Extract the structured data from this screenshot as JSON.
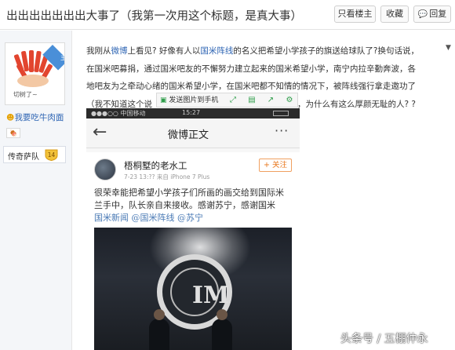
{
  "header": {
    "title": "出出出出出出出大事了（我第一次用这个标题，是真大事）",
    "buttons": {
      "owner_only": "只看楼主",
      "favorite": "收藏",
      "reply": "回复"
    }
  },
  "user": {
    "owner_tag": "楼主",
    "avatar_caption": "切树了~",
    "name": "我要吃牛肉面",
    "fan_badge": "🍖",
    "level_name": "传奇萨队",
    "level": "14"
  },
  "post": {
    "segments": [
      {
        "text": "我刚从",
        "link": false
      },
      {
        "text": "微博",
        "link": true
      },
      {
        "text": "上看见? 好像有人以",
        "link": false
      },
      {
        "text": "国米阵线",
        "link": true
      },
      {
        "text": "的名义把希望小学孩子的旗送给球队了?换句话说，",
        "link": false
      }
    ],
    "line2": "在国米吧募捐，通过国米吧友的不懈努力建立起来的国米希望小学，南宁内拉辛勤奔波，各",
    "line3": "地吧友为之牵动心绪的国米希望小学，在国米吧都不知情的情况下，被阵线强行拿走邀功了",
    "line4_left": "（我不知道这个说",
    "line4_right": "，为什么有这么厚颜无耻的人? ?"
  },
  "float_bar": {
    "send_to_phone": "发送图片到手机"
  },
  "screenshot": {
    "status": {
      "carrier": "●●●○○ 中国移动",
      "time": "15:27"
    },
    "nav_title": "微博正文",
    "weibo": {
      "author": "梧桐墅的老水工",
      "meta": "7-23 13:??  来自 iPhone 7 Plus",
      "follow": "+ 关注",
      "lines": [
        "很荣幸能把希望小学孩子们所画的画交给到国际米",
        "兰手中，队长亲自来接收。感谢苏宁，感谢国米"
      ],
      "tags": "国米新闻 @国米阵线 @苏宁"
    }
  },
  "watermark": "头条号 / 五棚仲永"
}
